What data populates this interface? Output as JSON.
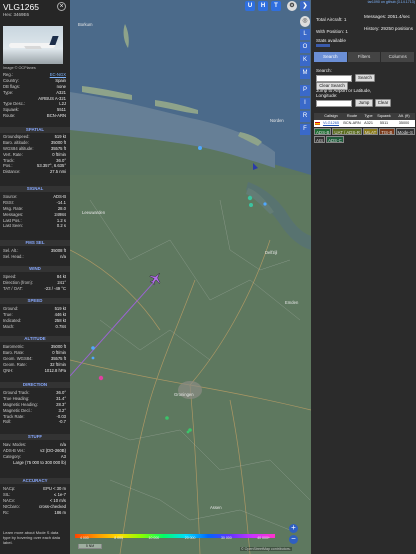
{
  "aircraft": {
    "callsign": "VLG1265",
    "hex_line": "Hex: 3469E6",
    "image_caption": "Image © OCPlanes"
  },
  "info_rows": [
    {
      "k": "Reg.:",
      "v": "EC-NGX",
      "link": true
    },
    {
      "k": "Country:",
      "v": "Spain"
    },
    {
      "k": "DB flags:",
      "v": "none"
    },
    {
      "k": "Type:",
      "v": "A321"
    },
    {
      "k": "",
      "v": "AIRBUS A-321"
    },
    {
      "k": "Type Desc.:",
      "v": "L2J"
    },
    {
      "k": "Squawk:",
      "v": "5511"
    },
    {
      "k": "Route:",
      "v": "BCN-ARN"
    }
  ],
  "sections": {
    "spatial": "SPATIAL",
    "signal": "SIGNAL",
    "fms": "FMS SEL",
    "wind": "WIND",
    "speed": "SPEED",
    "altitude": "ALTITUDE",
    "direction": "DIRECTION",
    "stuff": "STUFF",
    "accuracy": "ACCURACY"
  },
  "spatial_rows": [
    {
      "k": "Groundspeed:",
      "v": "519 kt"
    },
    {
      "k": "Baro. altitude:",
      "v": "35000 ft"
    },
    {
      "k": "WGS84 altitude:",
      "v": "35575 ft"
    },
    {
      "k": "Vert. Rate:",
      "v": "0 ft/min"
    },
    {
      "k": "Track:",
      "v": "36.0°"
    },
    {
      "k": "Pos.:",
      "v": "53.357°, 6.635°"
    },
    {
      "k": "Distance:",
      "v": "27.5 nmi"
    }
  ],
  "signal_rows": [
    {
      "k": "Source:",
      "v": "ADS-B"
    },
    {
      "k": "RSSI:",
      "v": "-14.1"
    },
    {
      "k": "Msg. Rate:",
      "v": "28.0"
    },
    {
      "k": "Messages:",
      "v": "24984"
    },
    {
      "k": "Last Pos.:",
      "v": "1.2 s"
    },
    {
      "k": "Last Seen:",
      "v": "0.2 s"
    }
  ],
  "fms_rows": [
    {
      "k": "Sel. Alt.:",
      "v": "35008 ft"
    },
    {
      "k": "Sel. Head.:",
      "v": "n/a"
    }
  ],
  "wind_rows": [
    {
      "k": "Speed:",
      "v": "84 kt"
    },
    {
      "k": "Direction (from):",
      "v": "241°"
    },
    {
      "k": "TAT / OAT:",
      "v": "-23 / -49 °C"
    }
  ],
  "speed_rows": [
    {
      "k": "Ground:",
      "v": "519 kt"
    },
    {
      "k": "True:",
      "v": "446 kt"
    },
    {
      "k": "Indicated:",
      "v": "258 kt"
    },
    {
      "k": "Mach:",
      "v": "0.784"
    }
  ],
  "altitude_rows": [
    {
      "k": "Barometric:",
      "v": "35000 ft"
    },
    {
      "k": "Baro. Rate:",
      "v": "0 ft/min"
    },
    {
      "k": "Geom. WGS84:",
      "v": "35575 ft"
    },
    {
      "k": "Geom. Rate:",
      "v": "32 ft/min"
    },
    {
      "k": "QNH:",
      "v": "1012.8 hPa"
    }
  ],
  "direction_rows": [
    {
      "k": "Ground Track:",
      "v": "36.0°"
    },
    {
      "k": "True Heading:",
      "v": "31.4°"
    },
    {
      "k": "Magnetic Heading:",
      "v": "28.3°"
    },
    {
      "k": "Magnetic Decl.:",
      "v": "3.2°"
    },
    {
      "k": "Track Rate:",
      "v": "-0.03"
    },
    {
      "k": "Roll:",
      "v": "-0.7"
    }
  ],
  "stuff_rows": [
    {
      "k": "Nav. Modes:",
      "v": "n/a"
    },
    {
      "k": "ADS-B Ver.:",
      "v": "v2 (DO-260B)"
    },
    {
      "k": "Category:",
      "v": "A3"
    },
    {
      "k": "",
      "v": "Large (75 000 to 300 000 lb)"
    }
  ],
  "accuracy_rows": [
    {
      "k": "NACp:",
      "v": "EPU < 30 m"
    },
    {
      "k": "SIL:",
      "v": "≤ 1e-7"
    },
    {
      "k": "NACv:",
      "v": "< 10 m/s"
    },
    {
      "k": "NICbaro:",
      "v": "cross-checked"
    },
    {
      "k": "Rc:",
      "v": "186 m"
    }
  ],
  "footer_text": "Learn more about Mode S data type by hovering over each data label.",
  "map": {
    "labels": [
      "Borkum",
      "Groningen",
      "Leeuwarden",
      "Delfzijl",
      "Assen",
      "Emden",
      "Norden"
    ],
    "top_buttons": [
      "U",
      "H",
      "T"
    ],
    "side_buttons": [
      "L",
      "O",
      "K",
      "M",
      "P",
      "I",
      "R",
      "F"
    ],
    "legend_values": [
      "4 000",
      "8 000",
      "10 000",
      "20 000",
      "30 000",
      "40 000+"
    ],
    "scale_label": "5 NM",
    "attribution": "© OpenStreetMap contributors."
  },
  "version_link": "tar1090 on github (3.14.1713)",
  "stats": {
    "total_aircraft": "Total Aircraft: 1",
    "with_position": "With Position: 1",
    "stats_available": "Stats available",
    "messages": "Messages: 2051.4/sec",
    "history": "History: 29250 positions"
  },
  "tabs": [
    "Search",
    "Filters",
    "Columns"
  ],
  "search": {
    "label": "Search:",
    "button": "Search",
    "clear_selection": "Clear Search",
    "jump_label": "Jump to Airport or Latitude, Longitude:",
    "jump_button": "Jump",
    "clear_button": "Clear"
  },
  "table": {
    "headers": [
      "Callsign",
      "Route",
      "Type",
      "Squawk",
      "Alt. (ft)"
    ],
    "rows": [
      {
        "callsign": "VLG1265",
        "route": "BCN-ARN",
        "type": "A321",
        "squawk": "5511",
        "alt": "35000"
      }
    ]
  },
  "source_tags": [
    {
      "label": "ADS-B",
      "color": "#1f6b33"
    },
    {
      "label": "UAT / ADS-R",
      "color": "#5a6b1f"
    },
    {
      "label": "MLAT",
      "color": "#8a7a1a"
    },
    {
      "label": "TIS-B",
      "color": "#7a3a1a"
    },
    {
      "label": "Mode-S",
      "color": "#333"
    },
    {
      "label": "AIS",
      "color": "#333"
    },
    {
      "label": "ADS-C",
      "color": "#1f5a3a"
    }
  ]
}
